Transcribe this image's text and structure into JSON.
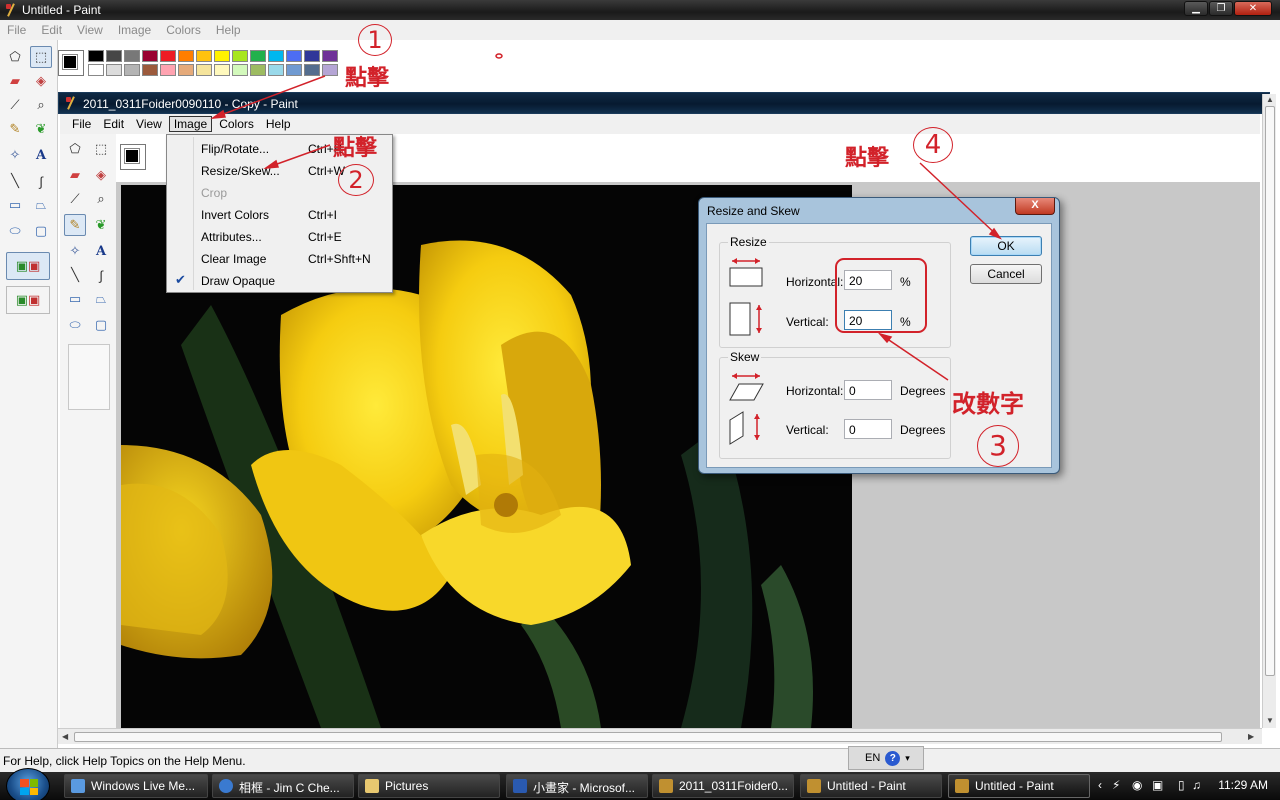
{
  "outer_window": {
    "title": "Untitled - Paint",
    "menu": [
      "File",
      "Edit",
      "View",
      "Image",
      "Colors",
      "Help"
    ]
  },
  "inner_window": {
    "title": "2011_0311Foider0090110 - Copy - Paint",
    "menu": [
      "File",
      "Edit",
      "View",
      "Image",
      "Colors",
      "Help"
    ]
  },
  "image_menu": {
    "items": [
      {
        "label": "Flip/Rotate...",
        "shortcut": "Ctrl+R",
        "disabled": false,
        "checked": false
      },
      {
        "label": "Resize/Skew...",
        "shortcut": "Ctrl+W",
        "disabled": false,
        "checked": false
      },
      {
        "label": "Crop",
        "shortcut": "",
        "disabled": true,
        "checked": false
      },
      {
        "label": "Invert Colors",
        "shortcut": "Ctrl+I",
        "disabled": false,
        "checked": false
      },
      {
        "label": "Attributes...",
        "shortcut": "Ctrl+E",
        "disabled": false,
        "checked": false
      },
      {
        "label": "Clear Image",
        "shortcut": "Ctrl+Shft+N",
        "disabled": false,
        "checked": false
      },
      {
        "label": "Draw Opaque",
        "shortcut": "",
        "disabled": false,
        "checked": true
      }
    ]
  },
  "dialog": {
    "title": "Resize and Skew",
    "close_label": "X",
    "resize_group": "Resize",
    "skew_group": "Skew",
    "resize_horizontal_label": "Horizontal:",
    "resize_horizontal_value": "20",
    "resize_vertical_label": "Vertical:",
    "resize_vertical_value": "20",
    "percent": "%",
    "skew_horizontal_label": "Horizontal:",
    "skew_horizontal_value": "0",
    "skew_vertical_label": "Vertical:",
    "skew_vertical_value": "0",
    "degrees": "Degrees",
    "ok_label": "OK",
    "cancel_label": "Cancel"
  },
  "annotations": {
    "n1": "1",
    "n2": "2",
    "n3": "3",
    "n4": "4",
    "click": "點擊",
    "change_number": "改數字"
  },
  "status_bar": {
    "text": "For Help, click Help Topics on the Help Menu.",
    "lang": "EN",
    "help": "?"
  },
  "taskbar": {
    "items": [
      "Windows Live Me...",
      "相框 - Jim C Che...",
      "Pictures",
      "小畫家 - Microsof...",
      "2011_0311Foider0...",
      "Untitled - Paint",
      "Untitled - Paint"
    ],
    "clock": "11:29 AM"
  },
  "colors": {
    "accent_red": "#d2222a",
    "palette_row1": [
      "#000000",
      "#464646",
      "#787878",
      "#990030",
      "#ed1c24",
      "#ff7e00",
      "#ffc20e",
      "#fff200",
      "#a8e61d",
      "#22b14c",
      "#00b7ef",
      "#4d6df3",
      "#2f3699",
      "#6f3198"
    ],
    "palette_row2": [
      "#ffffff",
      "#dcdcdc",
      "#b4b4b4",
      "#9c5a3c",
      "#ffa3b1",
      "#e5aa7a",
      "#f5e49c",
      "#fff9bd",
      "#d3f9bc",
      "#9dbb61",
      "#99d9ea",
      "#709ad1",
      "#546d8e",
      "#b5a5d5"
    ]
  }
}
